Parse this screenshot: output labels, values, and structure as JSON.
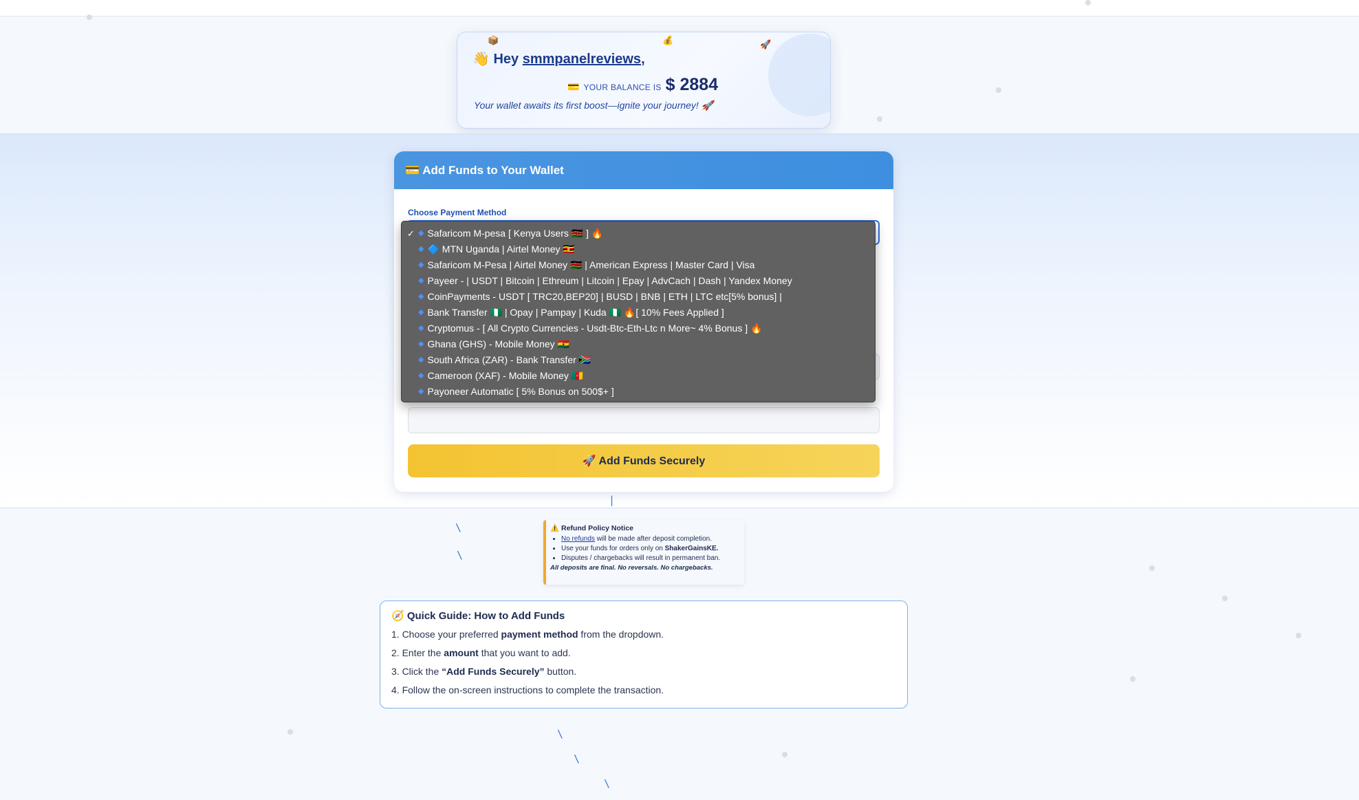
{
  "greeting": {
    "prefix": "Hey",
    "username": "smmpanelreviews",
    "suffix": ",",
    "balance_label": "YOUR BALANCE IS",
    "balance_value": "$ 2884",
    "subtitle": "Your wallet awaits its first boost—ignite your journey! 🚀",
    "wave_icon": "👋",
    "wallet_icon": "💳"
  },
  "funds": {
    "header": "💳 Add Funds to Your Wallet",
    "payment_label": "Choose Payment Method",
    "submit_label": "🚀 Add Funds Securely"
  },
  "dropdown": {
    "selected_index": 0,
    "options": [
      "Safaricom M-pesa [ Kenya Users 🇰🇪 ] 🔥",
      "🔷 MTN Uganda | Airtel Money 🇺🇬",
      "Safaricom M-Pesa | Airtel Money 🇰🇪 | American Express | Master Card | Visa",
      "Payeer - | USDT | Bitcoin | Ethreum | Litcoin | Epay | AdvCach | Dash | Yandex Money",
      " CoinPayments - USDT [ TRC20,BEP20] | BUSD | BNB | ETH | LTC etc[5% bonus] |",
      "Bank Transfer 🇳🇬 | Opay | Pampay | Kuda 🇳🇬 🔥[ 10% Fees Applied ]",
      " Cryptomus - [ All Crypto Currencies - Usdt-Btc-Eth-Ltc n More~ 4% Bonus ] 🔥",
      "Ghana (GHS) - Mobile Money 🇬🇭",
      "South Africa (ZAR) - Bank Transfer 🇿🇦",
      "Cameroon (XAF) - Mobile Money 🇨🇲",
      "Payoneer Automatic [ 5% Bonus on 500$+ ]"
    ]
  },
  "refund": {
    "title": "⚠️ Refund Policy Notice",
    "items": [
      {
        "lead": "No refunds",
        "rest": " will be made after deposit completion."
      },
      {
        "lead": "Use your funds for orders only on ",
        "rest": "ShakerGainsKE."
      },
      {
        "lead": "Disputes / chargebacks will result in permanent ban.",
        "rest": ""
      }
    ],
    "footer": "All deposits are final. No reversals. No chargebacks."
  },
  "guide": {
    "title": "🧭 Quick Guide: How to Add Funds",
    "steps": [
      {
        "a": "1. Choose your preferred ",
        "b": "payment method",
        "c": " from the dropdown."
      },
      {
        "a": "2. Enter the ",
        "b": "amount",
        "c": " that you want to add."
      },
      {
        "a": "3. Click the ",
        "b": "“Add Funds Securely”",
        "c": " button."
      },
      {
        "a": "4. Follow the on-screen instructions to complete the transaction.",
        "b": "",
        "c": ""
      }
    ]
  },
  "colors": {
    "accent": "#3e8fe0",
    "button": "#f3c332",
    "dropdown_bg": "#616161"
  }
}
